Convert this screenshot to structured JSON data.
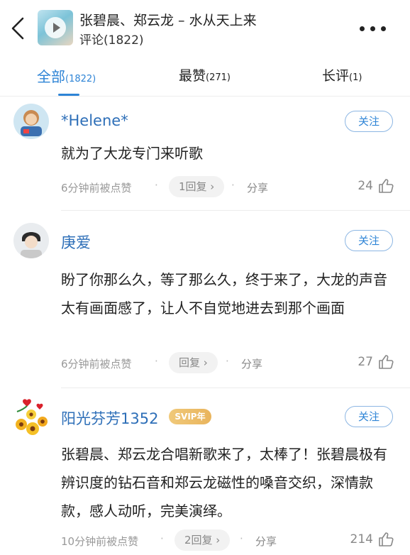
{
  "header": {
    "title": "张碧晨、郑云龙 – 水从天上来",
    "subtitle": "评论(1822)"
  },
  "tabs": [
    {
      "name": "全部",
      "count": "(1822)"
    },
    {
      "name": "最赞",
      "count": "(271)"
    },
    {
      "name": "长评",
      "count": "(1)"
    }
  ],
  "comments": [
    {
      "user": "*Helene*",
      "follow_label": "关注",
      "text": "就为了大龙专门来听歌",
      "time": "6分钟前被点赞",
      "reply_label": "1回复 ›",
      "share_label": "分享",
      "likes": "24"
    },
    {
      "user": "庚爱",
      "follow_label": "关注",
      "text": "盼了你那么久，等了那么久，终于来了，大龙的声音太有画面感了，让人不自觉地进去到那个画面",
      "time": "6分钟前被点赞",
      "reply_label": "回复 ›",
      "share_label": "分享",
      "likes": "27"
    },
    {
      "user": "阳光芬芳1352",
      "badge": "SVIP年",
      "follow_label": "关注",
      "text": "张碧晨、郑云龙合唱新歌来了，太棒了！张碧晨极有辨识度的钻石音和郑云龙磁性的嗓音交织，深情款款，感人动听，完美演绎。",
      "time": "10分钟前被点赞",
      "reply_label": "2回复 ›",
      "share_label": "分享",
      "likes": "214"
    }
  ],
  "colors": {
    "accent": "#2e84d6",
    "username": "#2e6fb8",
    "meta": "#999999",
    "svip": "#e9b45c"
  }
}
